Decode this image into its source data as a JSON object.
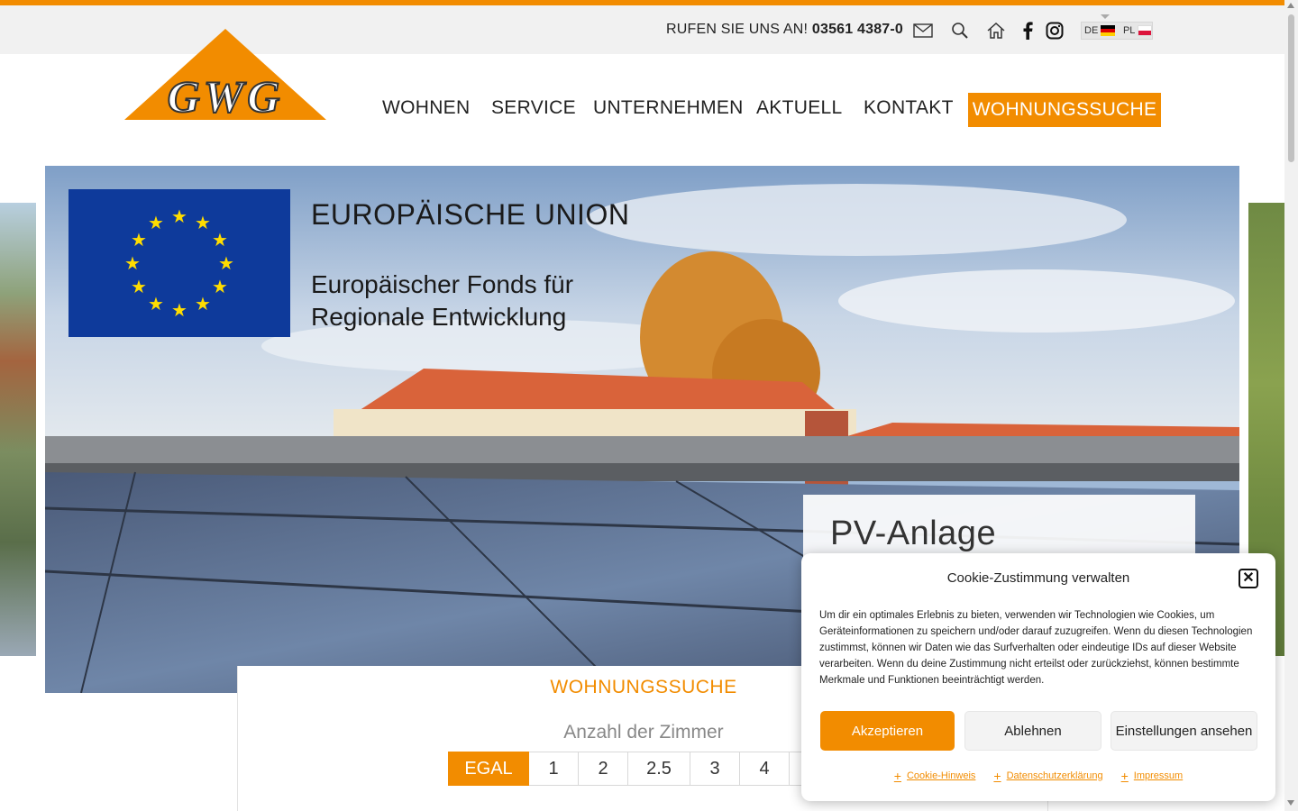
{
  "header": {
    "call_prefix": "RUFEN SIE UNS AN!",
    "phone": "03561 4387-0",
    "icons": [
      "mail-icon",
      "search-icon",
      "home-icon",
      "facebook-icon",
      "instagram-icon"
    ],
    "languages": [
      {
        "code": "DE",
        "flag": "flag-de"
      },
      {
        "code": "PL",
        "flag": "flag-pl"
      }
    ]
  },
  "logo": {
    "text": "GWG",
    "color": "#f28c00"
  },
  "nav": {
    "items": [
      "WOHNEN",
      "SERVICE",
      "UNTERNEHMEN",
      "AKTUELL",
      "KONTAKT"
    ],
    "cta": "WOHNUNGSSUCHE"
  },
  "hero": {
    "eu_title": "EUROPÄISCHE UNION",
    "eu_subtitle_line1": "Europäischer Fonds für",
    "eu_subtitle_line2": "Regionale Entwicklung",
    "card_title": "PV-Anlage"
  },
  "search": {
    "title": "WOHNUNGSSUCHE",
    "rooms_label": "Anzahl der Zimmer",
    "rooms": [
      "EGAL",
      "1",
      "2",
      "2.5",
      "3",
      "4"
    ],
    "selected": "EGAL"
  },
  "cookie": {
    "title": "Cookie-Zustimmung verwalten",
    "text": "Um dir ein optimales Erlebnis zu bieten, verwenden wir Technologien wie Cookies, um Geräteinformationen zu speichern und/oder darauf zuzugreifen. Wenn du diesen Technologien zustimmst, können wir Daten wie das Surfverhalten oder eindeutige IDs auf dieser Website verarbeiten. Wenn du deine Zustimmung nicht erteilst oder zurückziehst, können bestimmte Merkmale und Funktionen beeinträchtigt werden.",
    "accept": "Akzeptieren",
    "deny": "Ablehnen",
    "preferences": "Einstellungen ansehen",
    "links": [
      "Cookie-Hinweis",
      "Datenschutzerklärung",
      "Impressum"
    ]
  },
  "colors": {
    "accent": "#f28c00",
    "eu_blue": "#0e3a9b",
    "eu_star": "#ffdd00"
  }
}
